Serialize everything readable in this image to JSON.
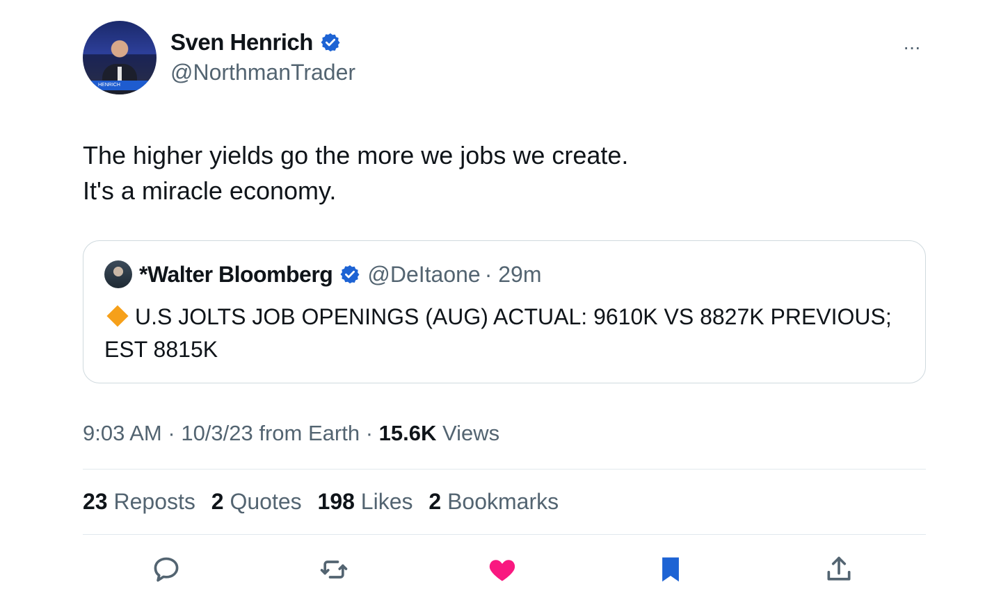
{
  "author": {
    "name": "Sven Henrich",
    "handle": "@NorthmanTrader",
    "avatar_caption": "HENRICH"
  },
  "more_menu_label": "···",
  "tweet": {
    "lines": [
      "The higher yields go the more we jobs we create.",
      "It's a miracle economy."
    ]
  },
  "quote": {
    "name": "*Walter Bloomberg",
    "handle": "@DeItaone",
    "age": "· 29m",
    "text": "U.S JOLTS JOB OPENINGS (AUG) ACTUAL: 9610K VS 8827K PREVIOUS; EST 8815K"
  },
  "meta": {
    "time": "9:03 AM",
    "sep1": "·",
    "date": "10/3/23 from Earth",
    "sep2": "·",
    "views_count": "15.6K",
    "views_label": "Views"
  },
  "stats": {
    "reposts_count": "23",
    "reposts_label": "Reposts",
    "quotes_count": "2",
    "quotes_label": "Quotes",
    "likes_count": "198",
    "likes_label": "Likes",
    "bookmarks_count": "2",
    "bookmarks_label": "Bookmarks"
  },
  "colors": {
    "verified": "#1d63d4",
    "like_active": "#f91880",
    "bookmark_active": "#1d63d4",
    "secondary_text": "#536471"
  }
}
